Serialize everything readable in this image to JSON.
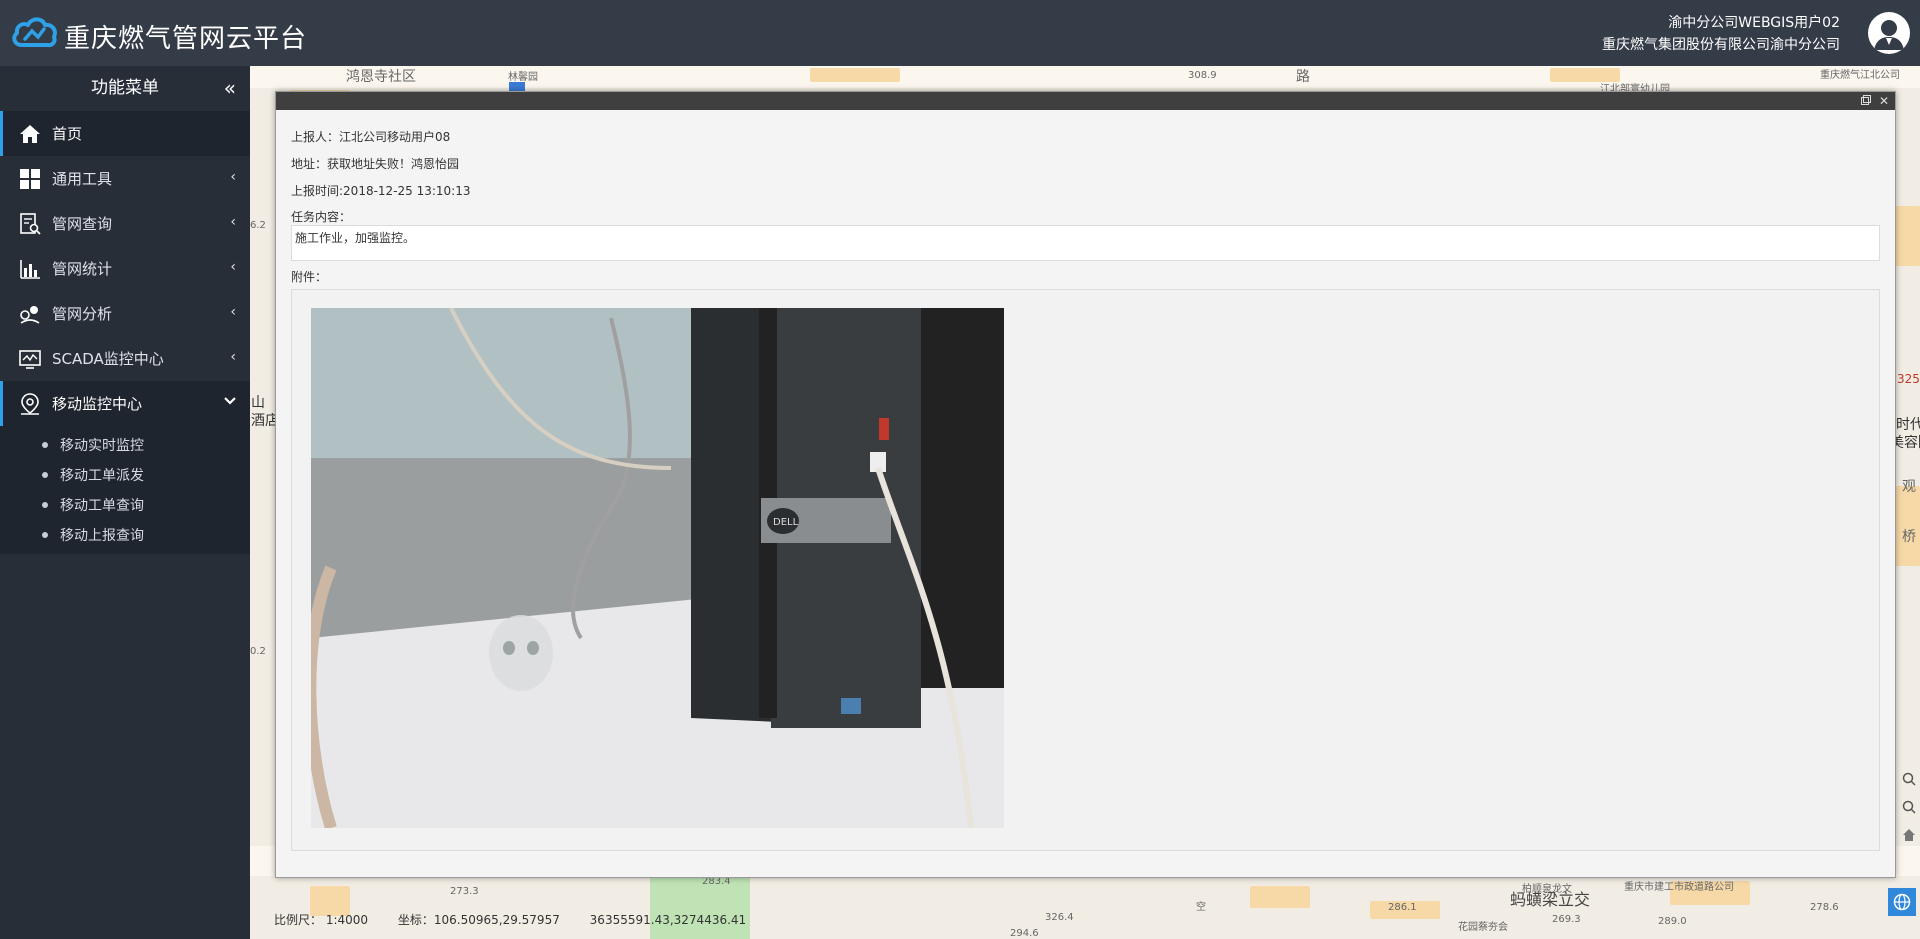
{
  "header": {
    "title": "重庆燃气管网云平台",
    "user_line1": "渝中分公司WEBGIS用户02",
    "user_line2": "重庆燃气集团股份有限公司渝中分公司",
    "brand_color": "#2fa1e8"
  },
  "sidebar": {
    "title": "功能菜单",
    "collapse_icon": "double-chevron-left-icon",
    "items": [
      {
        "label": "首页",
        "icon": "home-icon"
      },
      {
        "label": "通用工具",
        "icon": "grid-icon"
      },
      {
        "label": "管网查询",
        "icon": "document-search-icon"
      },
      {
        "label": "管网统计",
        "icon": "bar-chart-icon"
      },
      {
        "label": "管网分析",
        "icon": "pin-analysis-icon"
      },
      {
        "label": "SCADA监控中心",
        "icon": "monitor-icon"
      },
      {
        "label": "移动监控中心",
        "icon": "location-icon"
      }
    ],
    "submenu": [
      {
        "label": "移动实时监控"
      },
      {
        "label": "移动工单派发"
      },
      {
        "label": "移动工单查询"
      },
      {
        "label": "移动上报查询"
      }
    ]
  },
  "dialog": {
    "reporter": "上报人：江北公司移动用户08",
    "address": "地址：获取地址失败！鸿恩怡园",
    "report_time": "上报时间:2018-12-25 13:10:13",
    "task_label": "任务内容：",
    "task_content": "施工作业，加强监控。",
    "attachment_label": "附件："
  },
  "map": {
    "labels": {
      "l1": "鸿恩寺社区",
      "l2": "林馨园",
      "l3": "308.9",
      "l4": "路",
      "l5": "江北部寰幼儿园",
      "l6": "重庆燃气江北公司",
      "l7": "山",
      "l8": "酒店",
      "l9": "325",
      "l10": "时代",
      "l11": "美容院",
      "l12": "观",
      "l13": "桥",
      "l14": "273.3",
      "l15": "283.4",
      "l16": "326.4",
      "l17": "空",
      "l18": "蚂蟥梁立交",
      "l19": "柏顺泉龙文",
      "l20": "重庆市建工市政道路公司",
      "l21": "286.1",
      "l22": "花园蔡夯会",
      "l23": "269.3",
      "l24": "289.0",
      "l25": "278.6",
      "l26": "294.6",
      "l27": "6.2",
      "l28": "0.2"
    }
  },
  "statusbar": {
    "scale": "比例尺： 1:4000",
    "coords": "坐标：106.50965,29.57957",
    "projected": "36355591.43,3274436.41"
  }
}
